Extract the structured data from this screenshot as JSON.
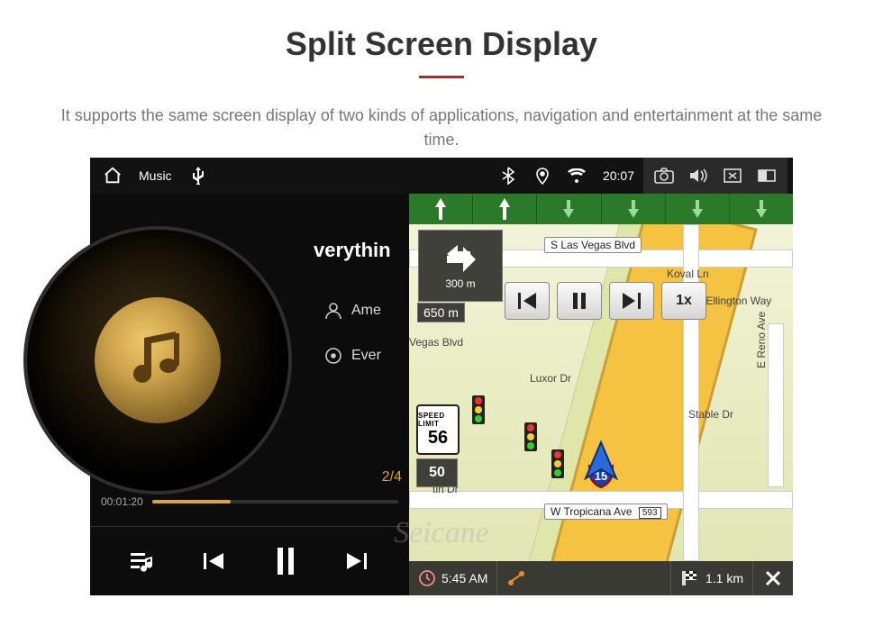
{
  "page": {
    "title": "Split Screen Display",
    "subtitle": "It supports the same screen display of two kinds of applications, navigation and entertainment at the same time."
  },
  "statusbar": {
    "app_label": "Music",
    "usb_icon": "usb-icon",
    "time": "20:07"
  },
  "music": {
    "track_title_visible": "verythin",
    "artist_visible": "Ame",
    "album_visible": "Ever",
    "index": "2/4",
    "elapsed": "00:01:20",
    "progress_pct": 32
  },
  "nav": {
    "turn": {
      "dist_next": "300 m",
      "dist_total": "650 m"
    },
    "sim_speed": "1x",
    "speed_limit": {
      "label": "SPEED LIMIT",
      "value": "56"
    },
    "current_speed": "50",
    "streets": {
      "top_label": "S Las Vegas Blvd",
      "bottom_label": "W Tropicana Ave",
      "bottom_ref": "593",
      "koval": "Koval Ln",
      "duke": "Duke Ellington Way",
      "vegas_blvd2": "Vegas Blvd",
      "luxor": "Luxor Dr",
      "stable": "Stable Dr",
      "reno": "E Reno Ave",
      "tin": "tin Dr"
    },
    "shields": {
      "i15": "15"
    },
    "bottom": {
      "eta": "5:45 AM",
      "remaining": "1.1 km"
    }
  },
  "watermark": "Seicane"
}
